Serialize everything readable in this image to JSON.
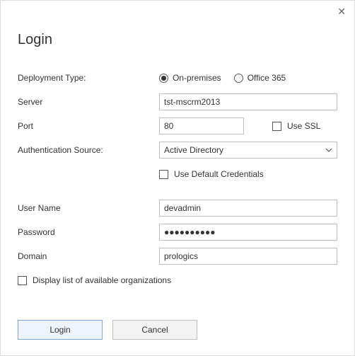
{
  "title": "Login",
  "close_glyph": "✕",
  "labels": {
    "deployment_type": "Deployment Type:",
    "server": "Server",
    "port": "Port",
    "auth_source": "Authentication Source:",
    "user_name": "User Name",
    "password": "Password",
    "domain": "Domain"
  },
  "radios": {
    "on_premises": "On-premises",
    "office_365": "Office 365",
    "selected": "on_premises"
  },
  "fields": {
    "server": "tst-mscrm2013",
    "port": "80",
    "auth_source_selected": "Active Directory",
    "user_name": "devadmin",
    "password_mask": "●●●●●●●●●●",
    "domain": "prologics"
  },
  "checks": {
    "use_ssl": "Use SSL",
    "use_default_credentials": "Use Default Credentials",
    "display_orgs": "Display list of available organizations"
  },
  "buttons": {
    "login": "Login",
    "cancel": "Cancel"
  }
}
